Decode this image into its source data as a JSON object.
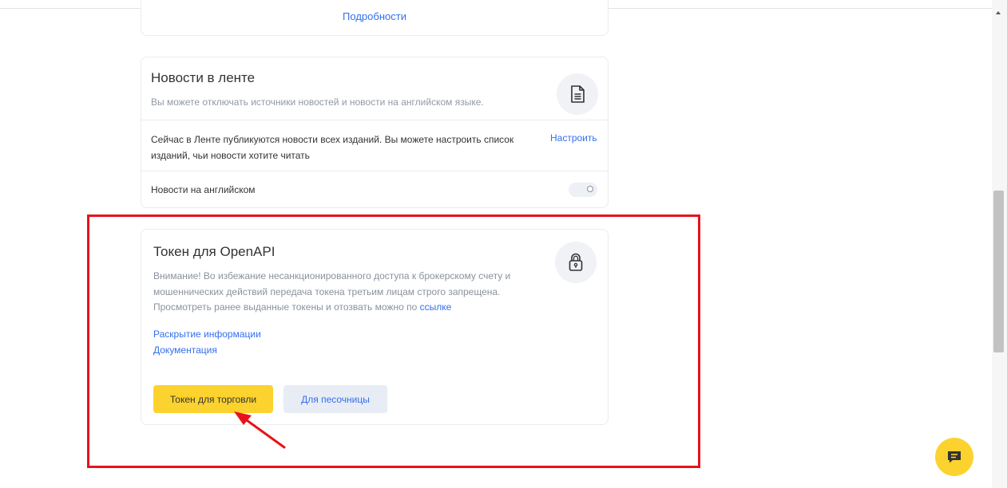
{
  "top_card": {
    "details_link": "Подробности"
  },
  "news": {
    "title": "Новости в ленте",
    "subtitle": "Вы можете отключать источники новостей и новости на английском языке.",
    "description": "Сейчас в Ленте публикуются новости всех изданий. Вы можете настроить список изданий, чьи новости хотите читать",
    "configure_link": "Настроить",
    "english_label": "Новости на английском",
    "english_enabled": false,
    "icon": "document-icon"
  },
  "token": {
    "title": "Токен для OpenAPI",
    "warning_text": "Внимание! Во избежание несанкционированного доступа к брокерскому счету и мошеннических действий передача токена третьим лицам строго запрещена. Просмотреть ранее выданные токены и отозвать можно по ",
    "warning_link": "ссылке",
    "disclosure_link": "Раскрытие информации",
    "docs_link": "Документация",
    "trade_button": "Токен для торговли",
    "sandbox_button": "Для песочницы",
    "icon": "lock-icon"
  },
  "colors": {
    "accent_yellow": "#fcd22e",
    "link_blue": "#336fee",
    "highlight_red": "#e8121c",
    "sandbox_bg": "#e8ecf5"
  },
  "chat": {
    "icon": "chat-icon"
  }
}
